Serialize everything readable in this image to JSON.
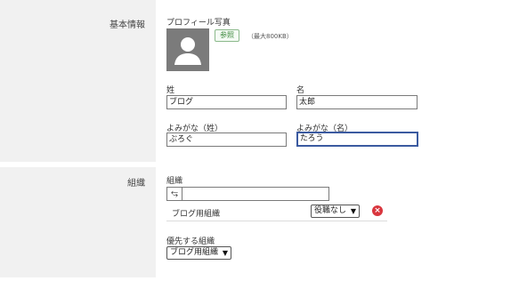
{
  "basic": {
    "section_title": "基本情報",
    "photo_label": "プロフィール写真",
    "browse_button": "参照",
    "size_hint": "（最大800KB）",
    "last_name_label": "姓",
    "last_name_value": "ブログ",
    "first_name_label": "名",
    "first_name_value": "太郎",
    "last_kana_label": "よみがな（姓）",
    "last_kana_value": "ぶろぐ",
    "first_kana_label": "よみがな（名）",
    "first_kana_value": "たろう"
  },
  "org": {
    "section_title": "組織",
    "org_label": "組織",
    "org_search_value": "",
    "org_row_name": "ブログ用組織",
    "role_select": "役職なし",
    "priority_label": "優先する組織",
    "priority_select": "ブログ用組織"
  },
  "icons": {
    "avatar": "person-silhouette-icon",
    "org_picker": "org-tree-icon",
    "delete": "remove-circle-icon",
    "caret": "chevron-down-icon"
  },
  "colors": {
    "label_bg": "#f1f1f1",
    "focus_border": "#3b5aa0",
    "delete_red": "#d9363e",
    "browse_green": "#3f8a3f"
  }
}
